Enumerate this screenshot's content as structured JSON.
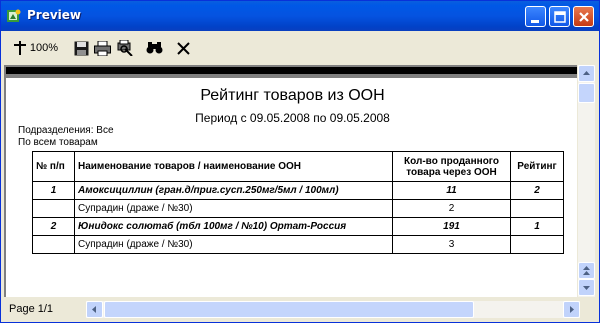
{
  "window": {
    "title": "Preview"
  },
  "toolbar": {
    "zoom_label": "100%",
    "icons": [
      "zoom-icon",
      "save-icon",
      "print-icon",
      "printer-setup-icon",
      "find-icon",
      "close-icon"
    ]
  },
  "report": {
    "title": "Рейтинг товаров из ООН",
    "period": "Период  с 09.05.2008 по 09.05.2008",
    "division": "Подразделения: Все",
    "scope": "По всем товарам",
    "columns": {
      "num": "№ п/п",
      "name": "Наименование товаров / наименование ООН",
      "qty": "Кол-во проданного товара через ООН",
      "rating": "Рейтинг"
    },
    "rows": [
      {
        "num": "1",
        "name": "Амоксициллин (гран.д/приг.сусп.250мг/5мл / 100мл)",
        "qty": "11",
        "rating": "2",
        "bold": true
      },
      {
        "num": "",
        "name": "Супрадин (драже  / №30)",
        "qty": "2",
        "rating": "",
        "bold": false
      },
      {
        "num": "2",
        "name": "Юнидокс солютаб (тбл 100мг / №10) Ортат-Россия",
        "qty": "191",
        "rating": "1",
        "bold": true
      },
      {
        "num": "",
        "name": "Супрадин (драже  / №30)",
        "qty": "3",
        "rating": "",
        "bold": false
      }
    ]
  },
  "status": {
    "page": "Page 1/1"
  },
  "colors": {
    "titlebar": "#0553e0",
    "chrome": "#ece9d8"
  }
}
